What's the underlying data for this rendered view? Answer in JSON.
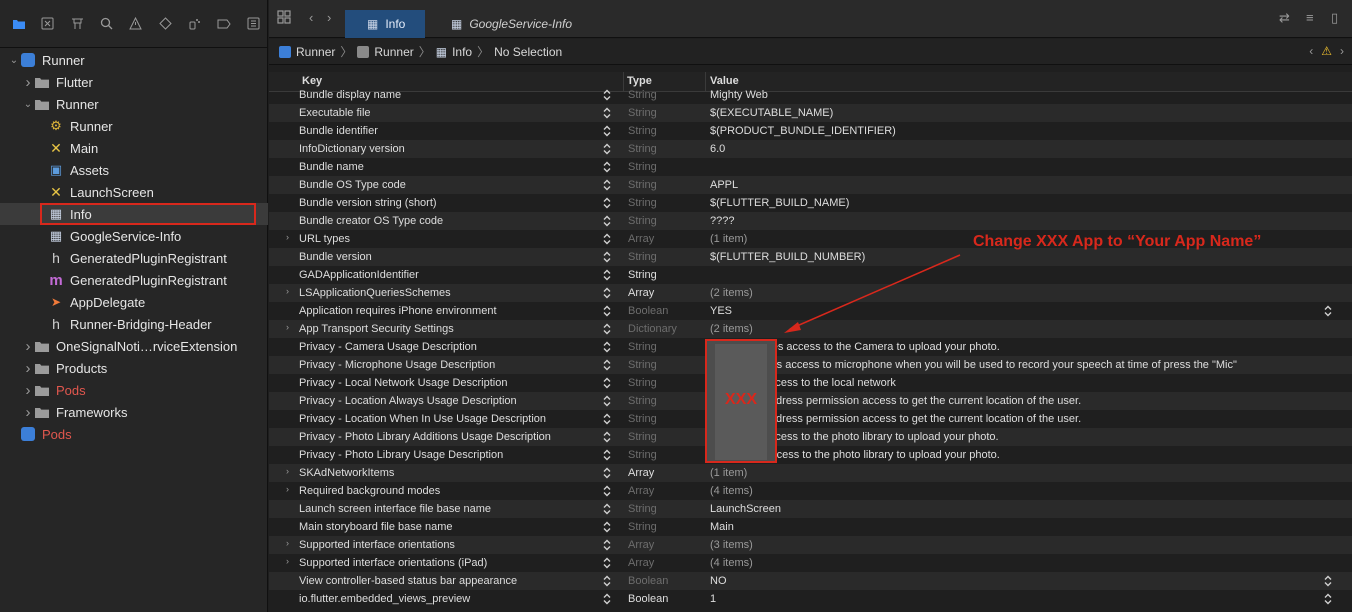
{
  "colors": {
    "accent": "#3b8cf5",
    "annotation": "#d8281c",
    "tab_active": "#234d7c"
  },
  "nav_toolbar": [
    {
      "name": "folder-icon",
      "active": true
    },
    {
      "name": "source-control-icon"
    },
    {
      "name": "symbol-hierarchy-icon"
    },
    {
      "name": "search-icon"
    },
    {
      "name": "warning-icon"
    },
    {
      "name": "test-diamond-icon"
    },
    {
      "name": "debug-spray-icon"
    },
    {
      "name": "breakpoint-icon"
    },
    {
      "name": "report-icon"
    }
  ],
  "tree": [
    {
      "label": "Runner",
      "level": 0,
      "disclosure": "open",
      "icon": "project-icon"
    },
    {
      "label": "Flutter",
      "level": 1,
      "disclosure": "closed",
      "icon": "folder-icon"
    },
    {
      "label": "Runner",
      "level": 1,
      "disclosure": "open",
      "icon": "folder-icon"
    },
    {
      "label": "Runner",
      "level": 2,
      "icon": "entitlements-icon"
    },
    {
      "label": "Main",
      "level": 2,
      "icon": "storyboard-icon"
    },
    {
      "label": "Assets",
      "level": 2,
      "icon": "assets-icon"
    },
    {
      "label": "LaunchScreen",
      "level": 2,
      "icon": "storyboard-icon"
    },
    {
      "label": "Info",
      "level": 2,
      "icon": "plist-icon",
      "selected": true
    },
    {
      "label": "GoogleService-Info",
      "level": 2,
      "icon": "plist-icon"
    },
    {
      "label": "GeneratedPluginRegistrant",
      "level": 2,
      "icon": "header-h-icon"
    },
    {
      "label": "GeneratedPluginRegistrant",
      "level": 2,
      "icon": "objc-m-icon"
    },
    {
      "label": "AppDelegate",
      "level": 2,
      "icon": "swift-icon"
    },
    {
      "label": "Runner-Bridging-Header",
      "level": 2,
      "icon": "header-h-icon"
    },
    {
      "label": "OneSignalNoti…rviceExtension",
      "level": 1,
      "disclosure": "closed",
      "icon": "folder-icon"
    },
    {
      "label": "Products",
      "level": 1,
      "disclosure": "closed",
      "icon": "folder-icon"
    },
    {
      "label": "Pods",
      "level": 1,
      "disclosure": "closed",
      "icon": "folder-icon",
      "red": true
    },
    {
      "label": "Frameworks",
      "level": 1,
      "disclosure": "closed",
      "icon": "folder-icon"
    },
    {
      "label": "Pods",
      "level": 0,
      "icon": "project-icon",
      "red": true
    }
  ],
  "tabs": [
    {
      "label": "Info",
      "active": true
    },
    {
      "label": "GoogleService-Info",
      "active": false
    }
  ],
  "jumpbar": {
    "items": [
      "Runner",
      "Runner",
      "Info",
      "No Selection"
    ]
  },
  "table": {
    "headers": {
      "key": "Key",
      "type": "Type",
      "value": "Value"
    },
    "rows": [
      {
        "key": "Bundle display name",
        "type": "String",
        "value": "Mighty Web"
      },
      {
        "key": "Executable file",
        "type": "String",
        "value": "$(EXECUTABLE_NAME)"
      },
      {
        "key": "Bundle identifier",
        "type": "String",
        "value": "$(PRODUCT_BUNDLE_IDENTIFIER)"
      },
      {
        "key": "InfoDictionary version",
        "type": "String",
        "value": "6.0"
      },
      {
        "key": "Bundle name",
        "type": "String",
        "value": ""
      },
      {
        "key": "Bundle OS Type code",
        "type": "String",
        "value": "APPL"
      },
      {
        "key": "Bundle version string (short)",
        "type": "String",
        "value": "$(FLUTTER_BUILD_NAME)"
      },
      {
        "key": "Bundle creator OS Type code",
        "type": "String",
        "value": "????"
      },
      {
        "key": "URL types",
        "type": "Array",
        "value": "(1 item)",
        "expandable": true
      },
      {
        "key": "Bundle version",
        "type": "String",
        "value": "$(FLUTTER_BUILD_NUMBER)"
      },
      {
        "key": "GADApplicationIdentifier",
        "type": "String",
        "value": "",
        "type_solid": true
      },
      {
        "key": "LSApplicationQueriesSchemes",
        "type": "Array",
        "value": "(2 items)",
        "expandable": true,
        "type_solid": true
      },
      {
        "key": "Application requires iPhone environment",
        "type": "Boolean",
        "value": "YES",
        "right_stepper": true
      },
      {
        "key": "App Transport Security Settings",
        "type": "Dictionary",
        "value": "(2 items)",
        "expandable": true
      },
      {
        "key": "Privacy - Camera Usage Description",
        "type": "String",
        "value": "M           app requires access to the Camera to upload your photo."
      },
      {
        "key": "Privacy - Microphone Usage Description",
        "type": "String",
        "value": "N           app requires access to microphone when you will be used to record your speech at time of  press the \"Mic\""
      },
      {
        "key": "Privacy - Local Network Usage Description",
        "type": "String",
        "value": "N           requires access to the local network"
      },
      {
        "key": "Privacy - Location Always Usage Description",
        "type": "String",
        "value": "N           requires address permission access to get the current location of the user."
      },
      {
        "key": "Privacy - Location When In Use Usage Description",
        "type": "String",
        "value": "N           requires address permission access to get the current location of the user."
      },
      {
        "key": "Privacy - Photo Library Additions Usage Description",
        "type": "String",
        "value": "N           requires access to the photo library to upload your photo."
      },
      {
        "key": "Privacy - Photo Library Usage Description",
        "type": "String",
        "value": "M           requires access to the photo library to upload your photo."
      },
      {
        "key": "SKAdNetworkItems",
        "type": "Array",
        "value": "(1 item)",
        "expandable": true,
        "type_solid": true
      },
      {
        "key": "Required background modes",
        "type": "Array",
        "value": "(4 items)",
        "expandable": true
      },
      {
        "key": "Launch screen interface file base name",
        "type": "String",
        "value": "LaunchScreen"
      },
      {
        "key": "Main storyboard file base name",
        "type": "String",
        "value": "Main"
      },
      {
        "key": "Supported interface orientations",
        "type": "Array",
        "value": "(3 items)",
        "expandable": true
      },
      {
        "key": "Supported interface orientations (iPad)",
        "type": "Array",
        "value": "(4 items)",
        "expandable": true
      },
      {
        "key": "View controller-based status bar appearance",
        "type": "Boolean",
        "value": "NO",
        "right_stepper": true
      },
      {
        "key": "io.flutter.embedded_views_preview",
        "type": "Boolean",
        "value": "1",
        "right_stepper": true,
        "type_solid": true
      }
    ]
  },
  "annotation": {
    "caption": "Change   XXX App to   “Your App Name”",
    "box_text": "XXX"
  }
}
